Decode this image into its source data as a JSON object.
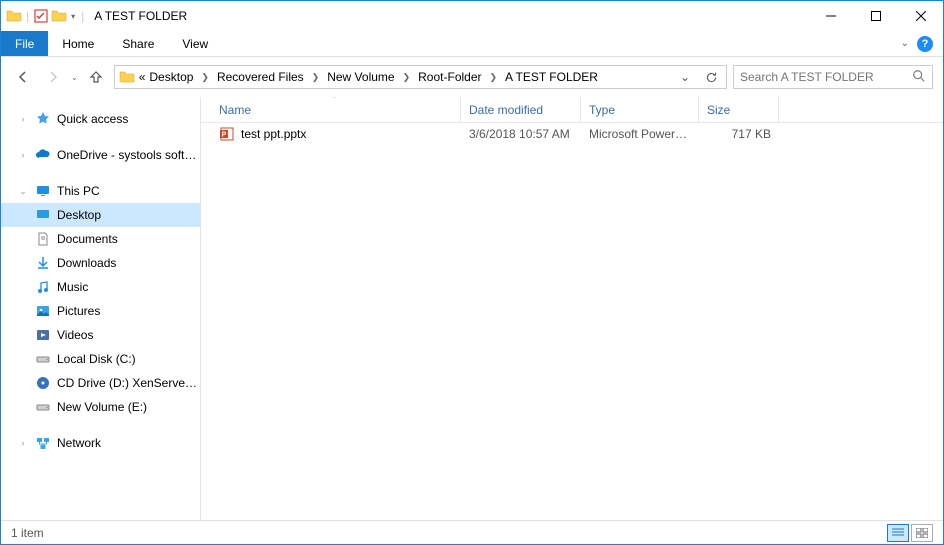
{
  "window": {
    "title": "A TEST FOLDER"
  },
  "ribbon": {
    "file": "File",
    "home": "Home",
    "share": "Share",
    "view": "View"
  },
  "breadcrumb": {
    "prefix": "«",
    "segments": [
      "Desktop",
      "Recovered Files",
      "New Volume",
      "Root-Folder",
      "A TEST FOLDER"
    ]
  },
  "search": {
    "placeholder": "Search A TEST FOLDER"
  },
  "sidebar": {
    "quick_access": "Quick access",
    "onedrive": "OneDrive - systools software",
    "this_pc": "This PC",
    "desktop": "Desktop",
    "documents": "Documents",
    "downloads": "Downloads",
    "music": "Music",
    "pictures": "Pictures",
    "videos": "Videos",
    "local_disk": "Local Disk (C:)",
    "cd_drive": "CD Drive (D:) XenServer Too",
    "new_volume": "New Volume (E:)",
    "network": "Network"
  },
  "columns": {
    "name": "Name",
    "date": "Date modified",
    "type": "Type",
    "size": "Size"
  },
  "files": [
    {
      "name": "test ppt.pptx",
      "date": "3/6/2018 10:57 AM",
      "type": "Microsoft PowerP...",
      "size": "717 KB",
      "kind": "powerpoint"
    }
  ],
  "status": {
    "count": "1 item"
  }
}
